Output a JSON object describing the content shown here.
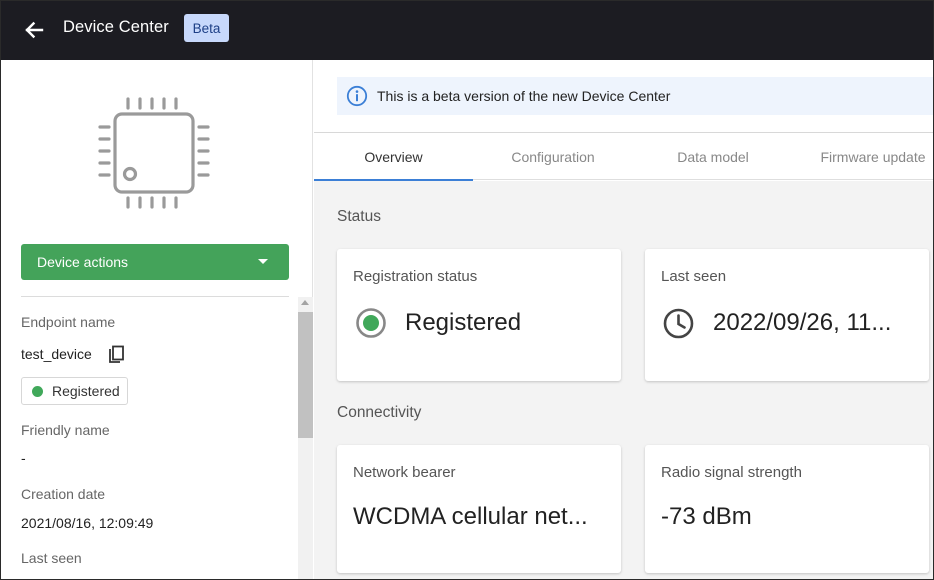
{
  "header": {
    "title": "Device Center",
    "badge": "Beta"
  },
  "sidebar": {
    "device_actions_label": "Device actions",
    "fields": {
      "endpoint_label": "Endpoint name",
      "endpoint_value": "test_device",
      "status_pill": "Registered",
      "friendly_label": "Friendly name",
      "friendly_value": "-",
      "creation_label": "Creation date",
      "creation_value": "2021/08/16, 12:09:49",
      "last_seen_label": "Last seen"
    }
  },
  "main": {
    "banner_text": "This is a beta version of the new Device Center",
    "tabs": [
      {
        "label": "Overview",
        "active": true
      },
      {
        "label": "Configuration",
        "active": false
      },
      {
        "label": "Data model",
        "active": false
      },
      {
        "label": "Firmware update",
        "active": false
      }
    ],
    "sections": {
      "status_title": "Status",
      "connectivity_title": "Connectivity"
    },
    "cards": {
      "registration_title": "Registration status",
      "registration_value": "Registered",
      "last_seen_title": "Last seen",
      "last_seen_value": "2022/09/26, 11...",
      "network_title": "Network bearer",
      "network_value": "WCDMA cellular net...",
      "signal_title": "Radio signal strength",
      "signal_value": "-73 dBm"
    }
  },
  "colors": {
    "topbar": "#1c1c22",
    "badge_bg": "#c7d8fb",
    "action_green": "#44a35a",
    "status_green": "#40a85a",
    "tab_indicator": "#3b7fd6",
    "banner_bg": "#eef4fd"
  },
  "icons": {
    "back": "arrow-left-icon",
    "device": "chip-icon",
    "copy": "copy-icon",
    "info": "info-icon",
    "registered": "radio-dot-icon",
    "clock": "clock-icon"
  }
}
